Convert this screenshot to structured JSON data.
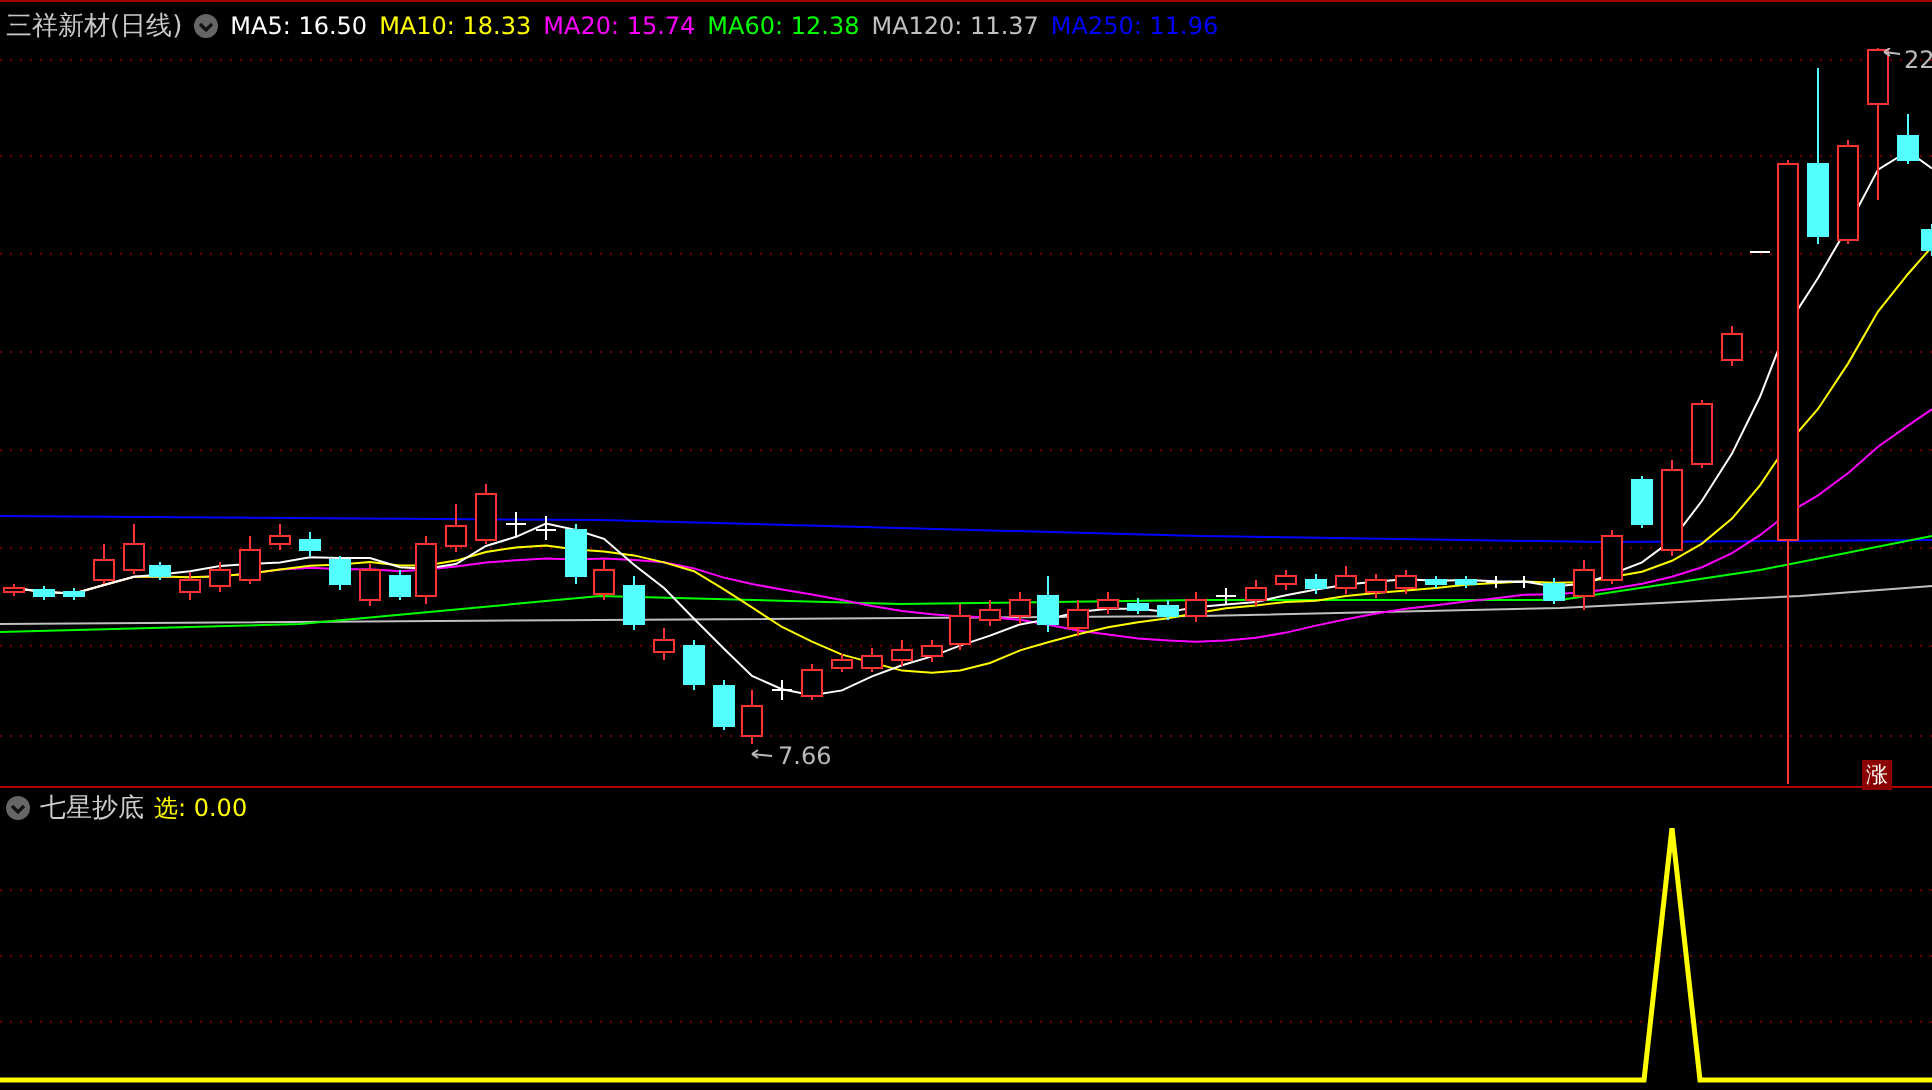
{
  "stock": {
    "name": "三祥新材(日线)"
  },
  "ma_legend": [
    {
      "label": "MA5: 16.50",
      "color": "#ffffff"
    },
    {
      "label": "MA10: 18.33",
      "color": "#ffff00"
    },
    {
      "label": "MA20: 15.74",
      "color": "#ff00ff"
    },
    {
      "label": "MA60: 12.38",
      "color": "#00ff00"
    },
    {
      "label": "MA120: 11.37",
      "color": "#c0c0c0"
    },
    {
      "label": "MA250: 11.96",
      "color": "#0000ff"
    }
  ],
  "price_labels": [
    {
      "text": "22",
      "kind": "high"
    },
    {
      "text": "7.66",
      "kind": "low"
    }
  ],
  "up_badge": "涨",
  "indicator": {
    "name": "七星抄底",
    "reading": "选: 0.00"
  }
}
